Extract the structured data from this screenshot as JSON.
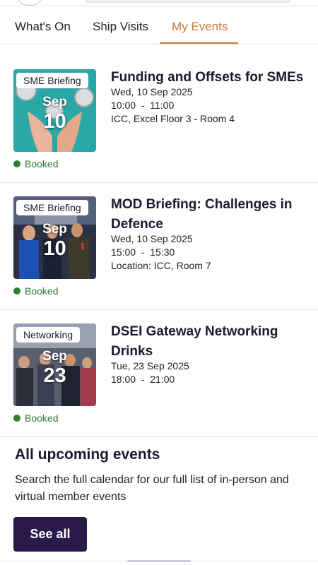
{
  "tabs": [
    {
      "label": "What's On"
    },
    {
      "label": "Ship Visits"
    },
    {
      "label": "My Events",
      "active": true
    }
  ],
  "colors": {
    "accent": "#c8773a",
    "booked": "#2e7d32",
    "button": "#2a1a4a"
  },
  "events": [
    {
      "badge": "SME Briefing",
      "month": "Sep",
      "day": "10",
      "title": "Funding and Offsets for SMEs",
      "date": "Wed, 10 Sep 2025",
      "time": "10:00  -  11:00",
      "location": "ICC, Excel Floor 3 - Room 4",
      "status": "Booked"
    },
    {
      "badge": "SME Briefing",
      "month": "Sep",
      "day": "10",
      "title": "MOD Briefing: Challenges in Defence",
      "date": "Wed, 10 Sep 2025",
      "time": "15:00  -  15:30",
      "location": "Location: ICC, Room 7",
      "status": "Booked"
    },
    {
      "badge": "Networking",
      "month": "Sep",
      "day": "23",
      "title": "DSEI Gateway Networking Drinks",
      "date": "Tue, 23 Sep 2025",
      "time": "18:00  -  21:00",
      "status": "Booked"
    }
  ],
  "upcoming": {
    "title": "All upcoming events",
    "text": "Search the full calendar for our full list of in-person and virtual member events",
    "button": "See all"
  }
}
